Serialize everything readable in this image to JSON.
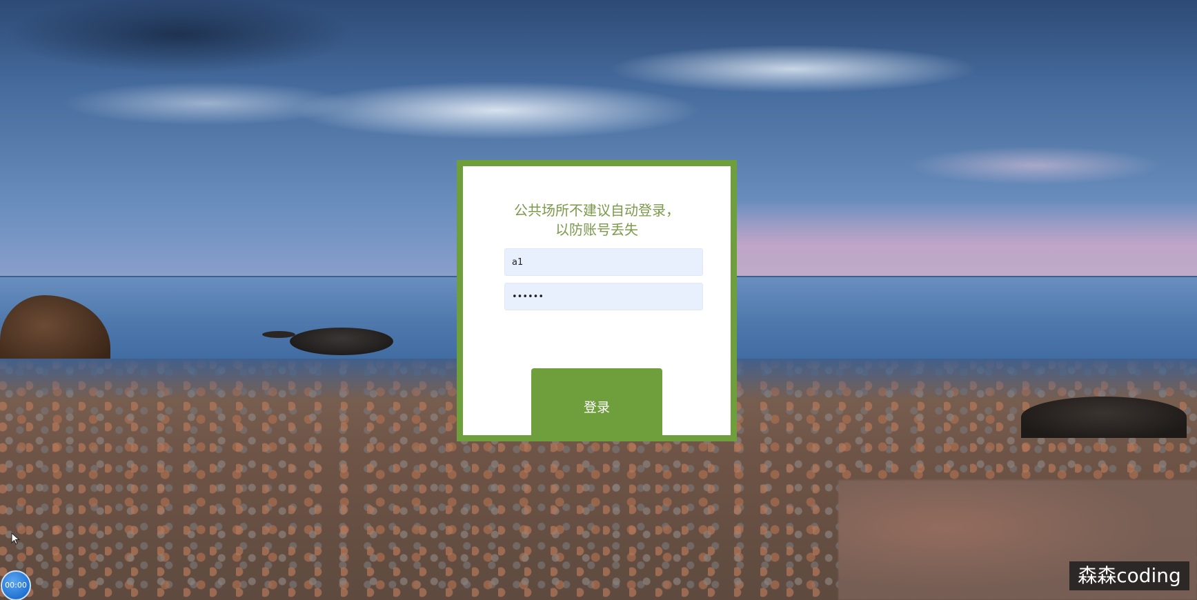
{
  "login": {
    "notice_line1": "公共场所不建议自动登录，",
    "notice_line2": "以防账号丢失",
    "username_value": "a1",
    "password_value": "••••••",
    "submit_label": "登录"
  },
  "overlay": {
    "timer_text": "00:00",
    "watermark_text": "森森coding"
  },
  "colors": {
    "accent_green": "#6f9e3c",
    "notice_text": "#7a9a4a",
    "input_background": "#e8f0fe",
    "timer_blue": "#1e6fcf"
  },
  "icons": {
    "cursor": "mouse-pointer-icon"
  }
}
